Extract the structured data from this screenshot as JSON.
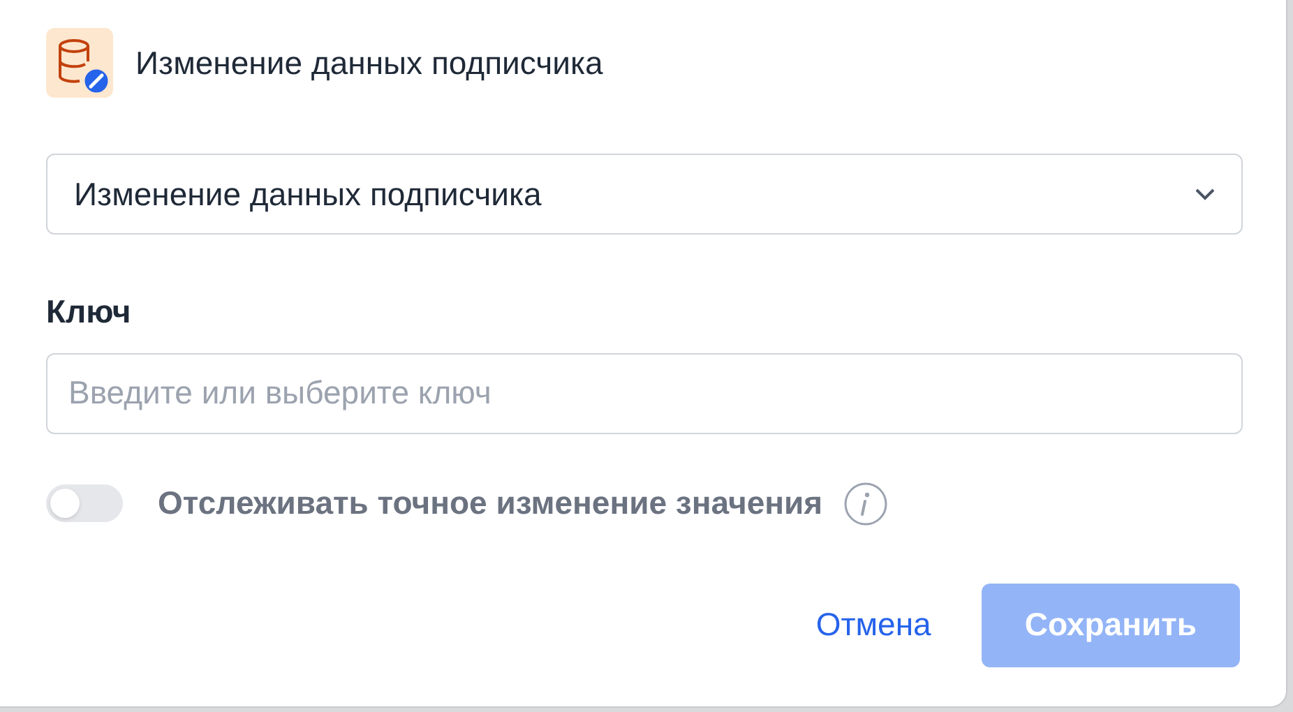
{
  "dialog": {
    "title": "Изменение данных подписчика"
  },
  "action_select": {
    "value": "Изменение данных подписчика"
  },
  "key": {
    "label": "Ключ",
    "placeholder": "Введите или выберите ключ"
  },
  "track_toggle": {
    "label": "Отслеживать точное изменение значения",
    "on": false
  },
  "buttons": [
    {
      "kind": "link",
      "label": "Отмена",
      "disabled": false
    },
    {
      "kind": "primary",
      "label": "Сохранить",
      "disabled": true
    }
  ]
}
